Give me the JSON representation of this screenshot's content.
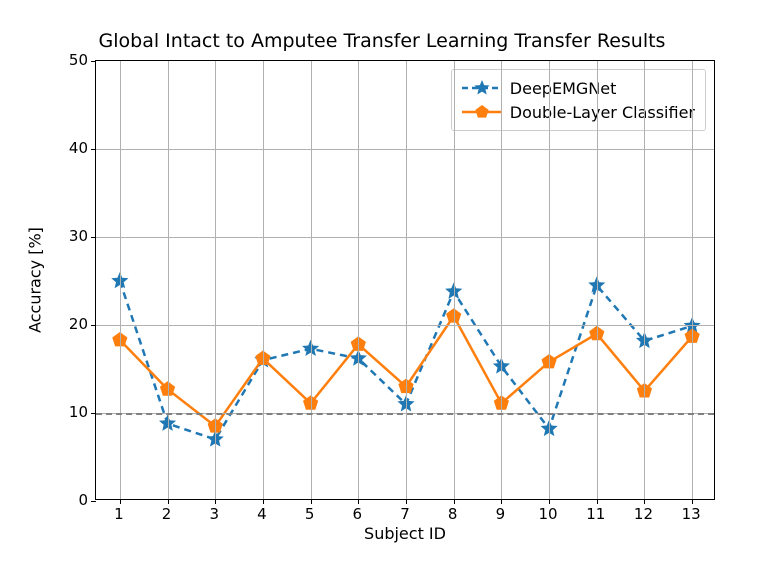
{
  "chart_data": {
    "type": "line",
    "title": "Global Intact to Amputee Transfer Learning Transfer Results",
    "xlabel": "Subject ID",
    "ylabel": "Accuracy [%]",
    "xlim": [
      0.5,
      13.5
    ],
    "ylim": [
      0,
      50
    ],
    "yticks": [
      0,
      10,
      20,
      30,
      40,
      50
    ],
    "categories": [
      1,
      2,
      3,
      4,
      5,
      6,
      7,
      8,
      9,
      10,
      11,
      12,
      13
    ],
    "reference_line": 10,
    "series": [
      {
        "name": "DeepEMGNet",
        "color": "#1f77b4",
        "style": "dashed",
        "marker": "star",
        "values": [
          25.0,
          8.8,
          7.0,
          16.0,
          17.3,
          16.2,
          11.0,
          23.8,
          15.3,
          8.2,
          24.5,
          18.2,
          19.9
        ]
      },
      {
        "name": "Double-Layer Classifier",
        "color": "#ff7f0e",
        "style": "solid",
        "marker": "pentagon",
        "values": [
          18.3,
          12.7,
          8.5,
          16.2,
          11.1,
          17.8,
          13.0,
          21.0,
          11.1,
          15.8,
          19.0,
          12.5,
          18.7
        ]
      }
    ],
    "legend_position": "upper-right",
    "grid": true
  }
}
